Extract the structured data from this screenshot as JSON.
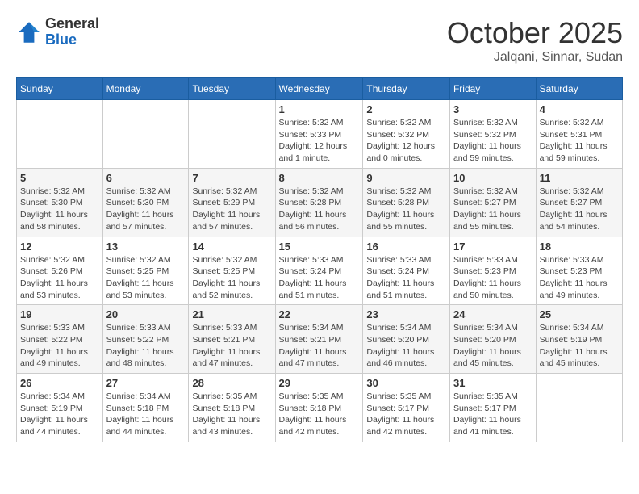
{
  "header": {
    "logo_general": "General",
    "logo_blue": "Blue",
    "month": "October 2025",
    "location": "Jalqani, Sinnar, Sudan"
  },
  "weekdays": [
    "Sunday",
    "Monday",
    "Tuesday",
    "Wednesday",
    "Thursday",
    "Friday",
    "Saturday"
  ],
  "weeks": [
    [
      {
        "day": "",
        "info": ""
      },
      {
        "day": "",
        "info": ""
      },
      {
        "day": "",
        "info": ""
      },
      {
        "day": "1",
        "info": "Sunrise: 5:32 AM\nSunset: 5:33 PM\nDaylight: 12 hours\nand 1 minute."
      },
      {
        "day": "2",
        "info": "Sunrise: 5:32 AM\nSunset: 5:32 PM\nDaylight: 12 hours\nand 0 minutes."
      },
      {
        "day": "3",
        "info": "Sunrise: 5:32 AM\nSunset: 5:32 PM\nDaylight: 11 hours\nand 59 minutes."
      },
      {
        "day": "4",
        "info": "Sunrise: 5:32 AM\nSunset: 5:31 PM\nDaylight: 11 hours\nand 59 minutes."
      }
    ],
    [
      {
        "day": "5",
        "info": "Sunrise: 5:32 AM\nSunset: 5:30 PM\nDaylight: 11 hours\nand 58 minutes."
      },
      {
        "day": "6",
        "info": "Sunrise: 5:32 AM\nSunset: 5:30 PM\nDaylight: 11 hours\nand 57 minutes."
      },
      {
        "day": "7",
        "info": "Sunrise: 5:32 AM\nSunset: 5:29 PM\nDaylight: 11 hours\nand 57 minutes."
      },
      {
        "day": "8",
        "info": "Sunrise: 5:32 AM\nSunset: 5:28 PM\nDaylight: 11 hours\nand 56 minutes."
      },
      {
        "day": "9",
        "info": "Sunrise: 5:32 AM\nSunset: 5:28 PM\nDaylight: 11 hours\nand 55 minutes."
      },
      {
        "day": "10",
        "info": "Sunrise: 5:32 AM\nSunset: 5:27 PM\nDaylight: 11 hours\nand 55 minutes."
      },
      {
        "day": "11",
        "info": "Sunrise: 5:32 AM\nSunset: 5:27 PM\nDaylight: 11 hours\nand 54 minutes."
      }
    ],
    [
      {
        "day": "12",
        "info": "Sunrise: 5:32 AM\nSunset: 5:26 PM\nDaylight: 11 hours\nand 53 minutes."
      },
      {
        "day": "13",
        "info": "Sunrise: 5:32 AM\nSunset: 5:25 PM\nDaylight: 11 hours\nand 53 minutes."
      },
      {
        "day": "14",
        "info": "Sunrise: 5:32 AM\nSunset: 5:25 PM\nDaylight: 11 hours\nand 52 minutes."
      },
      {
        "day": "15",
        "info": "Sunrise: 5:33 AM\nSunset: 5:24 PM\nDaylight: 11 hours\nand 51 minutes."
      },
      {
        "day": "16",
        "info": "Sunrise: 5:33 AM\nSunset: 5:24 PM\nDaylight: 11 hours\nand 51 minutes."
      },
      {
        "day": "17",
        "info": "Sunrise: 5:33 AM\nSunset: 5:23 PM\nDaylight: 11 hours\nand 50 minutes."
      },
      {
        "day": "18",
        "info": "Sunrise: 5:33 AM\nSunset: 5:23 PM\nDaylight: 11 hours\nand 49 minutes."
      }
    ],
    [
      {
        "day": "19",
        "info": "Sunrise: 5:33 AM\nSunset: 5:22 PM\nDaylight: 11 hours\nand 49 minutes."
      },
      {
        "day": "20",
        "info": "Sunrise: 5:33 AM\nSunset: 5:22 PM\nDaylight: 11 hours\nand 48 minutes."
      },
      {
        "day": "21",
        "info": "Sunrise: 5:33 AM\nSunset: 5:21 PM\nDaylight: 11 hours\nand 47 minutes."
      },
      {
        "day": "22",
        "info": "Sunrise: 5:34 AM\nSunset: 5:21 PM\nDaylight: 11 hours\nand 47 minutes."
      },
      {
        "day": "23",
        "info": "Sunrise: 5:34 AM\nSunset: 5:20 PM\nDaylight: 11 hours\nand 46 minutes."
      },
      {
        "day": "24",
        "info": "Sunrise: 5:34 AM\nSunset: 5:20 PM\nDaylight: 11 hours\nand 45 minutes."
      },
      {
        "day": "25",
        "info": "Sunrise: 5:34 AM\nSunset: 5:19 PM\nDaylight: 11 hours\nand 45 minutes."
      }
    ],
    [
      {
        "day": "26",
        "info": "Sunrise: 5:34 AM\nSunset: 5:19 PM\nDaylight: 11 hours\nand 44 minutes."
      },
      {
        "day": "27",
        "info": "Sunrise: 5:34 AM\nSunset: 5:18 PM\nDaylight: 11 hours\nand 44 minutes."
      },
      {
        "day": "28",
        "info": "Sunrise: 5:35 AM\nSunset: 5:18 PM\nDaylight: 11 hours\nand 43 minutes."
      },
      {
        "day": "29",
        "info": "Sunrise: 5:35 AM\nSunset: 5:18 PM\nDaylight: 11 hours\nand 42 minutes."
      },
      {
        "day": "30",
        "info": "Sunrise: 5:35 AM\nSunset: 5:17 PM\nDaylight: 11 hours\nand 42 minutes."
      },
      {
        "day": "31",
        "info": "Sunrise: 5:35 AM\nSunset: 5:17 PM\nDaylight: 11 hours\nand 41 minutes."
      },
      {
        "day": "",
        "info": ""
      }
    ]
  ]
}
